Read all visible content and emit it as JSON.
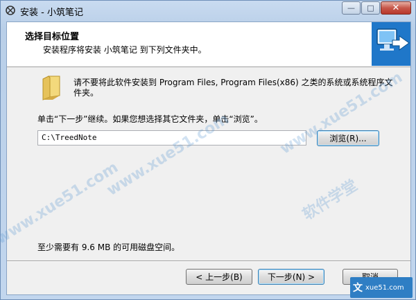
{
  "window": {
    "title": "安装 - 小筑笔记",
    "caption_buttons": {
      "minimize": "—",
      "maximize": "□",
      "close": "✕"
    }
  },
  "header": {
    "title": "选择目标位置",
    "subtitle": "安装程序将安装 小筑笔记 到下列文件夹中。"
  },
  "body": {
    "description": "请不要将此软件安装到 Program Files, Program Files(x86) 之类的系统或系统程序文件夹。",
    "instruction": "单击“下一步”继续。如果您想选择其它文件夹，单击“浏览”。",
    "install_path": "C:\\TreedNote",
    "browse_label": "浏览(R)...",
    "disk_space": "至少需要有 9.6 MB 的可用磁盘空间。"
  },
  "footer": {
    "back_label": "< 上一步(B)",
    "next_label": "下一步(N) >",
    "cancel_label": "取消"
  },
  "watermark": {
    "text1": "www.xue51.com",
    "text2": "软件学堂",
    "corner": "xue51.com"
  },
  "colors": {
    "accent": "#3c7fb1",
    "window_frame": "#b9cfe8",
    "close_button": "#c7574a"
  }
}
